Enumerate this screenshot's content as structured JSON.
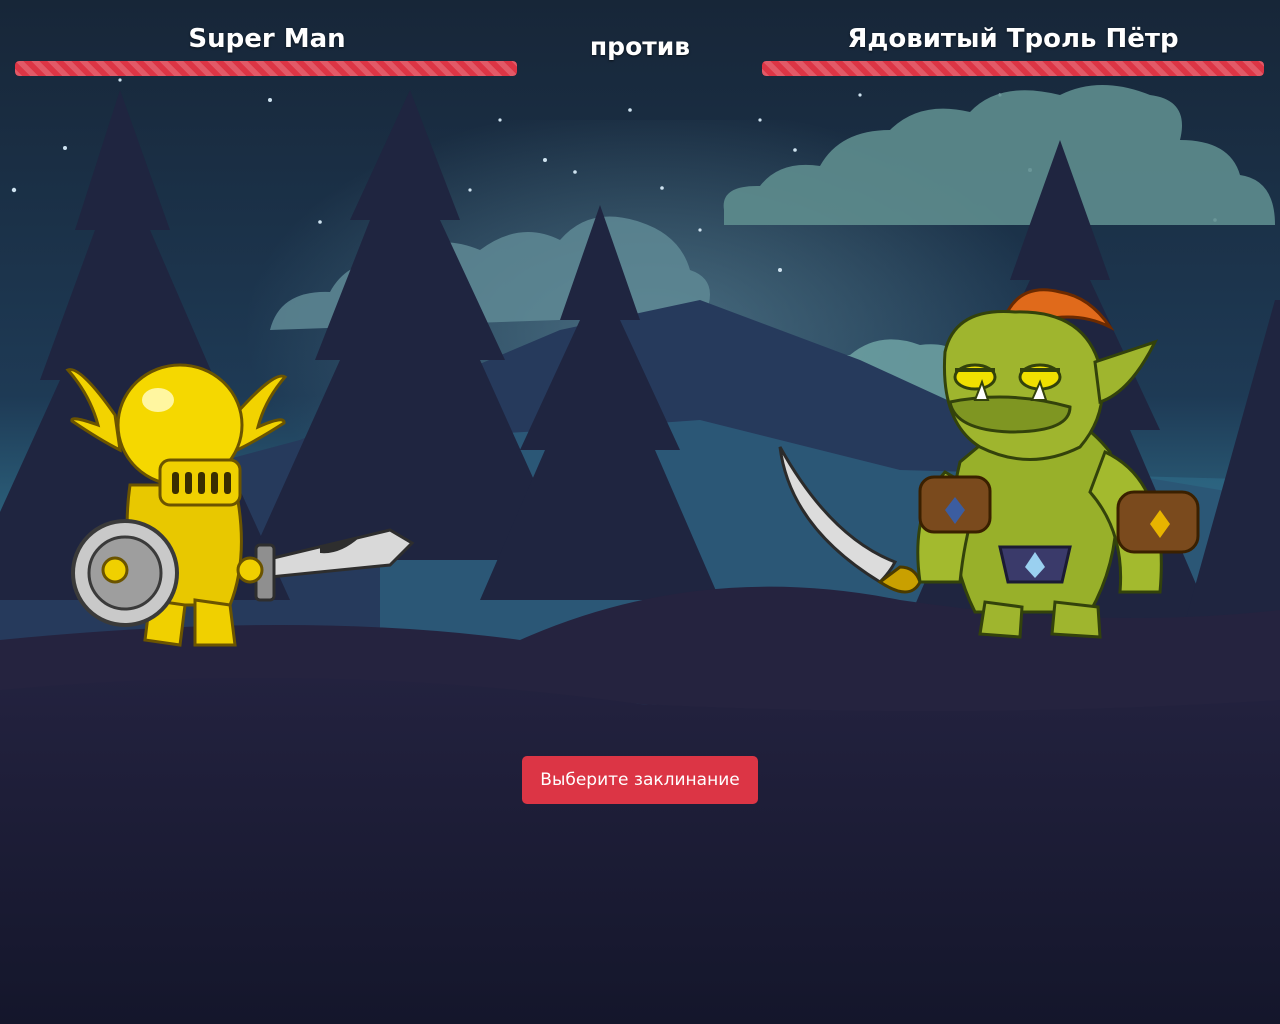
{
  "hero": {
    "name": "Super Man",
    "health": 1.0,
    "health_color": "#dc3545"
  },
  "versus_label": "против",
  "enemy": {
    "name": "Ядовитый Троль Пётр",
    "health": 1.0,
    "health_color": "#dc3545"
  },
  "actions": {
    "choose_spell_label": "Выберите заклинание"
  },
  "scene": {
    "background": "night-forest-mountains",
    "sky_color": "#1a2a40",
    "ground_color": "#1b1d36"
  },
  "sprites": {
    "hero": "golden-winged-knight",
    "enemy": "green-troll-with-scimitar"
  }
}
